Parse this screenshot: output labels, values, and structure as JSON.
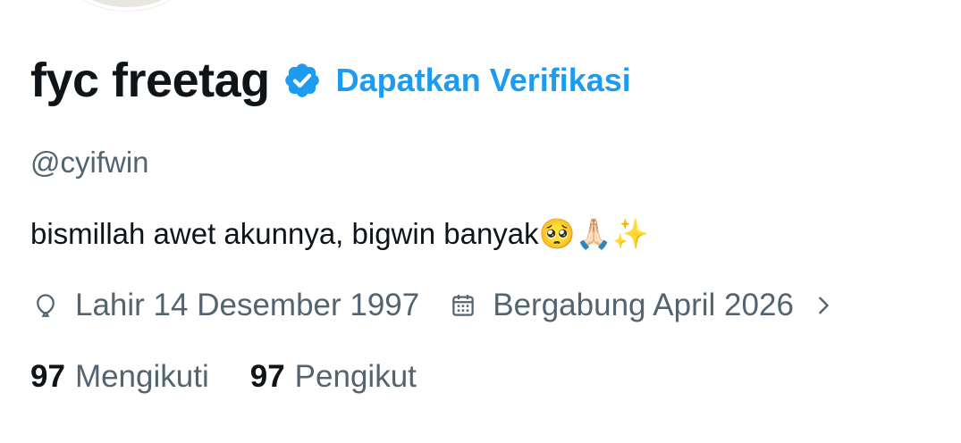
{
  "profile": {
    "display_name": "fyc freetag",
    "get_verified_label": "Dapatkan Verifikasi",
    "handle": "@cyifwin",
    "bio": "bismillah awet akunnya, bigwin banyak🥺🙏🏻✨",
    "birth_date": "Lahir 14 Desember 1997",
    "join_date": "Bergabung April 2026"
  },
  "stats": {
    "following_count": "97",
    "following_label": "Mengikuti",
    "followers_count": "97",
    "followers_label": "Pengikut"
  },
  "icons": {
    "verified": "verified-badge-icon",
    "birth": "balloon-icon",
    "join": "calendar-icon",
    "more": "chevron-right-icon"
  },
  "colors": {
    "accent": "#1d9bf0",
    "text_primary": "#0f1419",
    "text_secondary": "#536471"
  }
}
